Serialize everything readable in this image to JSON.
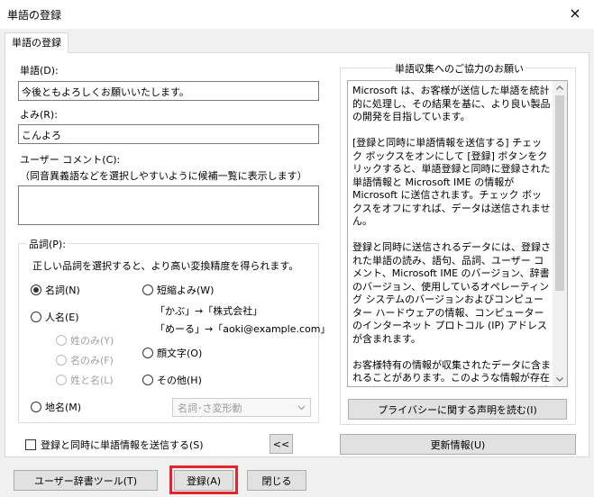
{
  "window": {
    "title": "単語の登録",
    "close_icon": "×"
  },
  "tab": {
    "label": "単語の登録"
  },
  "word": {
    "label": "単語(D):",
    "value": "今後ともよろしくお願いいたします。"
  },
  "reading": {
    "label": "よみ(R):",
    "value": "こんよろ"
  },
  "comment": {
    "label": "ユーザー コメント(C):",
    "hint": "（同音異義語などを選択しやすいように候補一覧に表示します）",
    "value": ""
  },
  "pos": {
    "legend": "品詞(P):",
    "description": "正しい品詞を選択すると、より高い変換精度を得られます。",
    "options": {
      "noun": "名詞(N)",
      "person": "人名(E)",
      "surname": "姓のみ(Y)",
      "given_name": "名のみ(F)",
      "full_name": "姓と名(L)",
      "place": "地名(M)",
      "short_reading": "短縮よみ(W)",
      "example1": "「かぶ」→「株式会社」",
      "example2": "「めーる」→「aoki@example.com」",
      "emoticon": "顔文字(O)",
      "other": "その他(H)"
    },
    "selected": "noun",
    "dropdown_value": "名詞･さ変形動"
  },
  "send_checkbox": {
    "label": "登録と同時に単語情報を送信する(S)",
    "checked": false
  },
  "collapse_button": "<<",
  "info": {
    "legend": "単語収集へのご協力のお願い",
    "text": "Microsoft は、お客様が送信した単語を統計的に処理し、その結果を基に、より良い製品の開発を目指しています。\n\n[登録と同時に単語情報を送信する] チェック ボックスをオンにして [登録] ボタンをクリックすると、単語登録と同時に登録された単語情報と Microsoft IME の情報が Microsoft に送信されます。チェック ボックスをオフにすれば、データは送信されません。\n\n登録と同時に送信されるデータには、登録された単語の読み、語句、品詞、ユーザー コメント、Microsoft IME のバージョン、辞書のバージョン、使用しているオペレーティング システムのバージョンおよびコンピューター ハードウェアの情報、コンピューターのインターネット プロトコル (IP) アドレスが含まれます。\n\nお客様特有の情報が収集されたデータに含まれることがあります。このような情報が存在する場合でも、Microsoft では、お客様を特定するために使用することはありません。",
    "privacy_button": "プライバシーに関する声明を読む(I)",
    "update_button": "更新情報(U)"
  },
  "footer": {
    "dictionary_tool": "ユーザー辞書ツール(T)",
    "register": "登録(A)",
    "close": "閉じる"
  },
  "colors": {
    "highlight": "#e1262d",
    "window_bg": "#f0f0f0"
  }
}
